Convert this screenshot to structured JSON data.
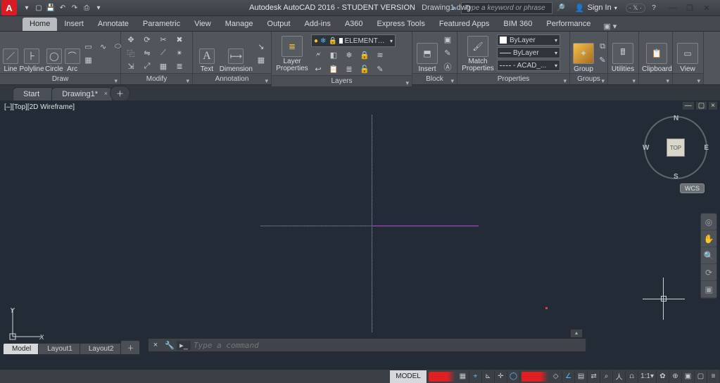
{
  "title": {
    "app": "Autodesk AutoCAD 2016 - STUDENT VERSION",
    "file": "Drawing1.dwg"
  },
  "search": {
    "placeholder": "Type a keyword or phrase"
  },
  "signin": {
    "label": "Sign In"
  },
  "ribbon_tabs": [
    "Home",
    "Insert",
    "Annotate",
    "Parametric",
    "View",
    "Manage",
    "Output",
    "Add-ins",
    "A360",
    "Express Tools",
    "Featured Apps",
    "BIM 360",
    "Performance"
  ],
  "active_ribbon_tab": "Home",
  "panels": {
    "draw": {
      "title": "Draw",
      "line": "Line",
      "polyline": "Polyline",
      "circle": "Circle",
      "arc": "Arc"
    },
    "modify": {
      "title": "Modify"
    },
    "annotation": {
      "title": "Annotation",
      "text": "Text",
      "dimension": "Dimension"
    },
    "layers": {
      "title": "Layers",
      "props": "Layer\nProperties",
      "combo": "ELEMENTO EM VIST..."
    },
    "block": {
      "title": "Block",
      "insert": "Insert"
    },
    "match": {
      "title": "Properties",
      "match": "Match\nProperties",
      "bylayer": "ByLayer",
      "bylayer2": "ByLayer",
      "acad": "- ACAD_..."
    },
    "groups": {
      "title": "Groups",
      "group": "Group"
    },
    "utilities": {
      "title": "Utilities"
    },
    "clipboard": {
      "title": "Clipboard"
    },
    "view": {
      "title": "View"
    }
  },
  "filetabs": {
    "start": "Start",
    "drawing": "Drawing1*"
  },
  "viewport_label": "[–][Top][2D Wireframe]",
  "viewcube": {
    "face": "TOP",
    "n": "N",
    "s": "S",
    "e": "E",
    "w": "W",
    "wcs": "WCS"
  },
  "cmd": {
    "placeholder": "Type a command"
  },
  "modeltabs": {
    "model": "Model",
    "layout1": "Layout1",
    "layout2": "Layout2"
  },
  "status": {
    "model": "MODEL",
    "scale": "1:1"
  }
}
